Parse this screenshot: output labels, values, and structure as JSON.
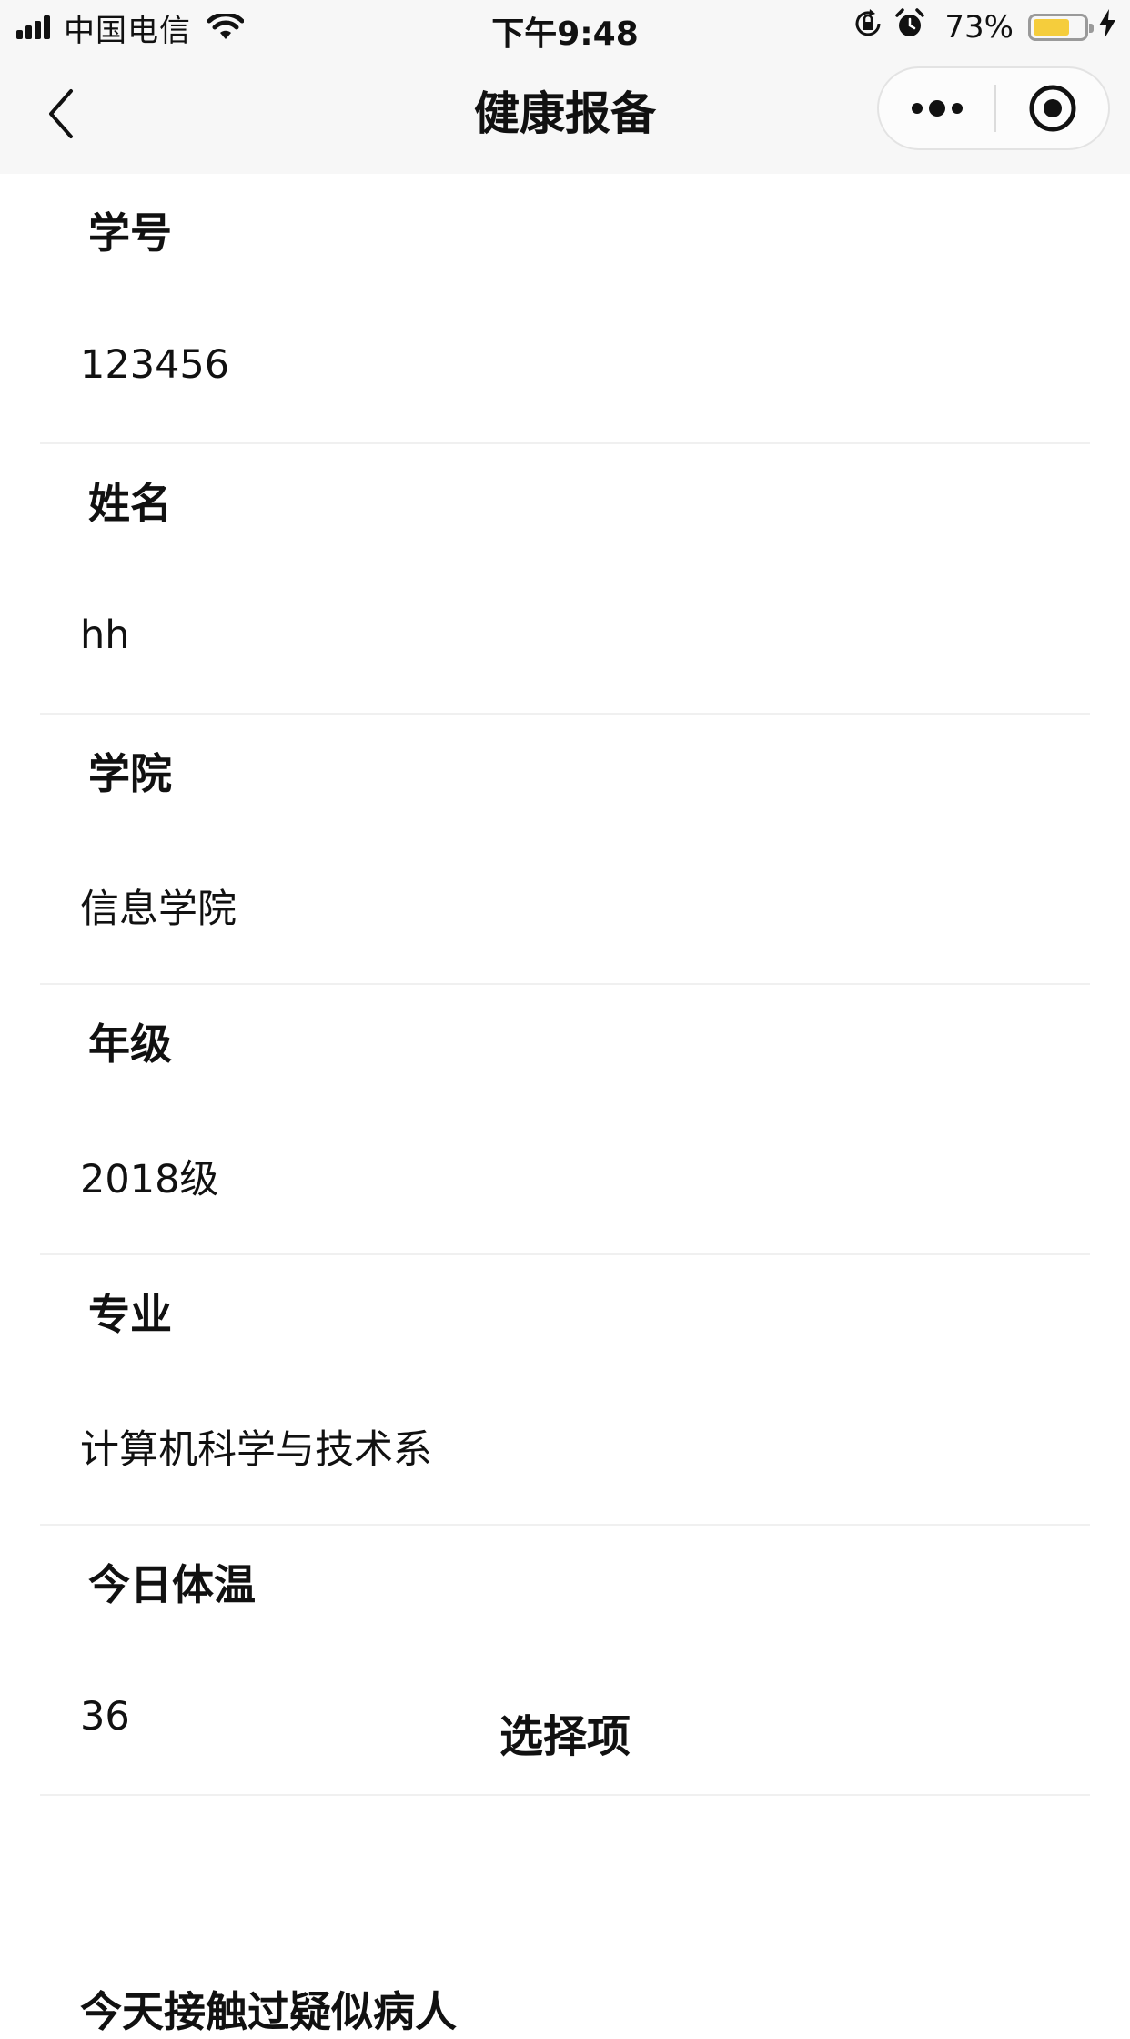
{
  "status_bar": {
    "carrier": "中国电信",
    "time": "下午9:48",
    "battery_percent_label": "73%",
    "battery_level": 0.73,
    "icons": [
      "signal-icon",
      "wifi-icon",
      "rotation-lock-icon",
      "alarm-icon",
      "battery-icon",
      "charging-icon"
    ]
  },
  "nav": {
    "title": "健康报备",
    "back_icon": "chevron-left-icon",
    "more_icon": "more-dots-icon",
    "close_icon": "target-circle-icon"
  },
  "form": {
    "fields": [
      {
        "label": "学号",
        "value": "123456"
      },
      {
        "label": "姓名",
        "value": "hh"
      },
      {
        "label": "学院",
        "value": "信息学院"
      },
      {
        "label": "年级",
        "value": "2018级"
      },
      {
        "label": "专业",
        "value": "计算机科学与技术系"
      },
      {
        "label": "今日体温",
        "value": "36"
      }
    ],
    "section_title": "选择项",
    "next_item_partial": "今天接触过疑似病人"
  }
}
